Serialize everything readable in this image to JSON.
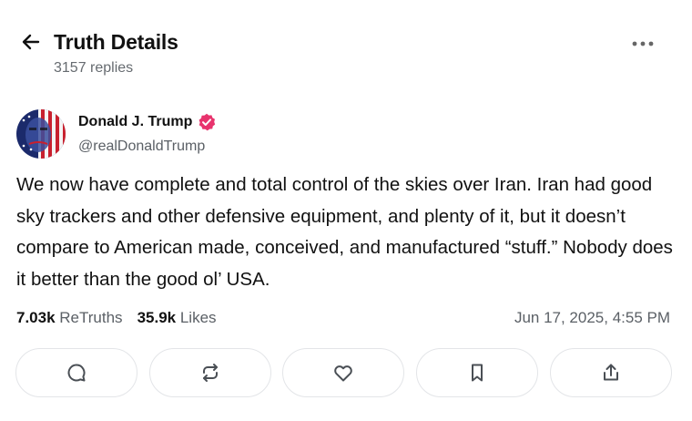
{
  "header": {
    "title": "Truth Details",
    "replies": "3157 replies",
    "back_icon": "arrow-left-icon",
    "more_icon": "more-horizontal-icon"
  },
  "post": {
    "author_name": "Donald J. Trump",
    "handle": "@realDonaldTrump",
    "verified": true,
    "body": "We now have complete and total control of the skies over Iran. Iran had good sky trackers and other defensive equipment, and plenty of it, but it doesn’t compare to American made, conceived, and manufactured “stuff.”  Nobody does it better than the good ol’ USA.",
    "retruths_count": "7.03k",
    "retruths_label": "ReTruths",
    "likes_count": "35.9k",
    "likes_label": "Likes",
    "timestamp": "Jun 17, 2025, 4:55 PM"
  },
  "actions": [
    {
      "icon": "reply-icon"
    },
    {
      "icon": "retruth-icon"
    },
    {
      "icon": "like-icon"
    },
    {
      "icon": "bookmark-icon"
    },
    {
      "icon": "share-icon"
    }
  ],
  "colors": {
    "text_primary": "#111111",
    "text_secondary": "#5b6066",
    "verified_badge": "#e8336d",
    "button_border": "#e3e5e8",
    "icon_gray": "#4a4f55"
  }
}
